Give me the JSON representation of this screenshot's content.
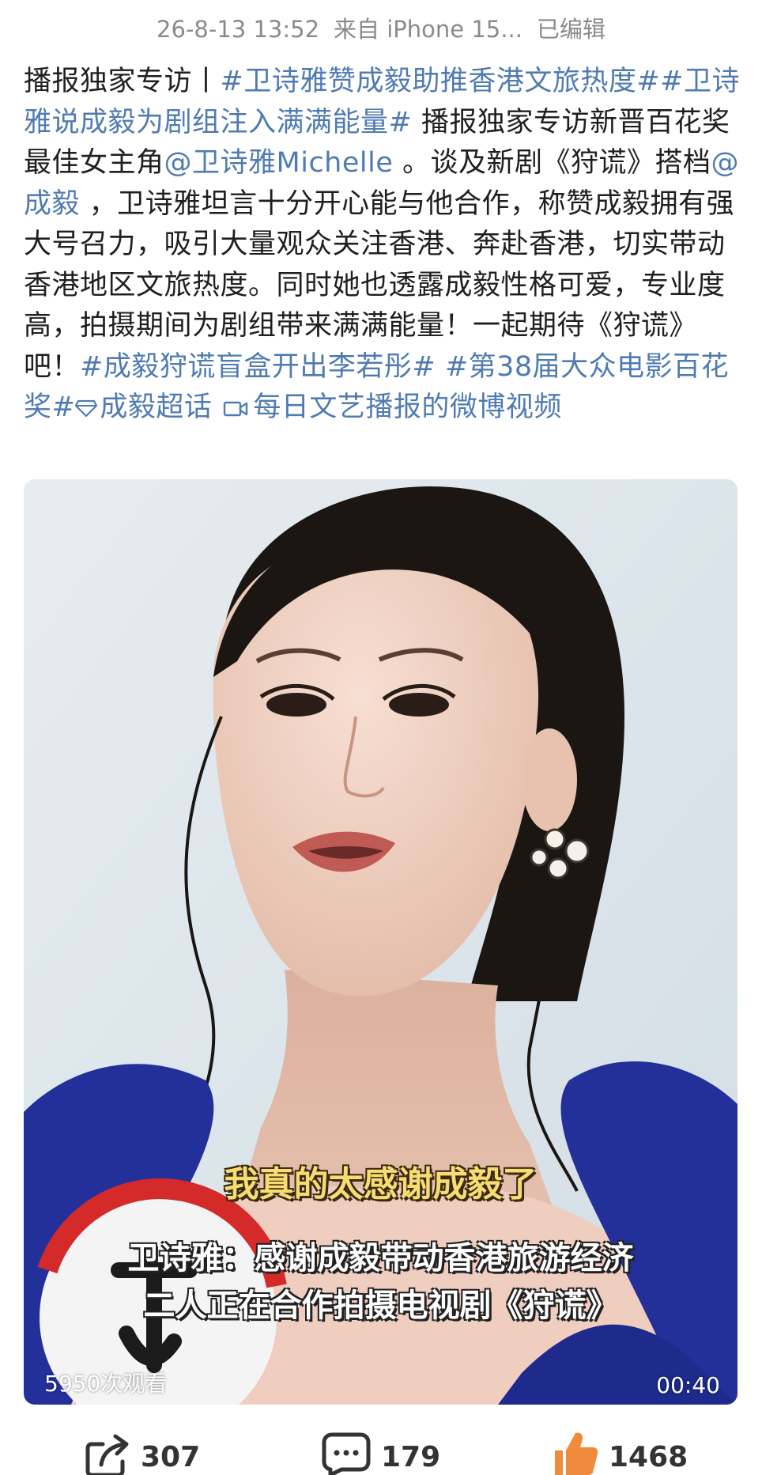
{
  "meta": {
    "date": "26-8-13 13:52",
    "source": "来自 iPhone 15...",
    "edited": "已编辑"
  },
  "post": {
    "p1": "播报独家专访丨",
    "tag1": "#卫诗雅赞成毅助推香港文旅热度#",
    "tag2": "#卫诗雅说成毅为剧组注入满满能量#",
    "p2": " 播报独家专访新晋百花奖最佳女主角",
    "mention1": "@卫诗雅Michelle",
    "p3": " 。谈及新剧《狩谎》搭档",
    "mention2": "@成毅",
    "p4": " ，卫诗雅坦言十分开心能与他合作，称赞成毅拥有强大号召力，吸引大量观众关注香港、奔赴香港，切实带动香港地区文旅热度。同时她也透露成毅性格可爱，专业度高，拍摄期间为剧组带来满满能量！一起期待《狩谎》吧！",
    "tag3": "#成毅狩谎盲盒开出李若彤#",
    "tag4": "#第38届大众电影百花奖#",
    "supertopic": "成毅超话",
    "video_link": "每日文艺播报的微博视频"
  },
  "video": {
    "subtitle_main": "我真的太感谢成毅了",
    "caption_line1": "卫诗雅：感谢成毅带动香港旅游经济",
    "caption_line2": "二人正在合作拍摄电视剧《狩谎》",
    "view_count": "5950次观看",
    "duration": "00:40"
  },
  "actions": {
    "repost_count": "307",
    "comment_count": "179",
    "like_count": "1468"
  },
  "colors": {
    "link": "#4f7bb2",
    "like": "#f08a3c",
    "dress": "#23309a"
  },
  "icons": {
    "supertopic": "diamond-icon",
    "video": "video-camera-icon",
    "repost": "share-arrow-icon",
    "comment": "comment-bubble-icon",
    "like": "thumbs-up-icon"
  }
}
